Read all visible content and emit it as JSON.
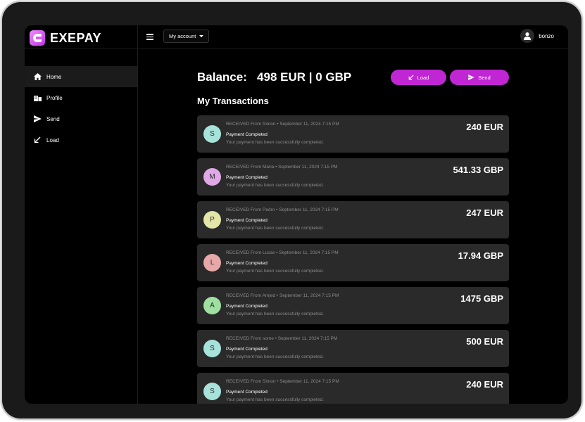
{
  "app": {
    "name": "EXEPAY"
  },
  "header": {
    "account_menu": "My account",
    "username": "bonzo"
  },
  "sidebar": {
    "items": [
      {
        "label": "Home",
        "icon": "home-icon",
        "active": true
      },
      {
        "label": "Profile",
        "icon": "profile-icon",
        "active": false
      },
      {
        "label": "Send",
        "icon": "send-icon",
        "active": false
      },
      {
        "label": "Load",
        "icon": "load-icon",
        "active": false
      }
    ]
  },
  "balance": {
    "label": "Balance:",
    "value": "498 EUR | 0 GBP"
  },
  "actions": {
    "load_label": "Load",
    "send_label": "Send"
  },
  "transactions_title": "My Transactions",
  "transactions": [
    {
      "initial": "S",
      "avatar_color": "#a7e3da",
      "meta": "RECEIVED From Simon • September 11, 2024 7:15 PM",
      "status": "Payment Completed",
      "description": "Your payment has been successfully completed.",
      "amount": "240 EUR"
    },
    {
      "initial": "M",
      "avatar_color": "#e0a8e6",
      "meta": "RECEIVED From Maria • September 11, 2024 7:15 PM",
      "status": "Payment Completed",
      "description": "Your payment has been successfully completed.",
      "amount": "541.33 GBP"
    },
    {
      "initial": "P",
      "avatar_color": "#e3e6a6",
      "meta": "RECEIVED From Pedro • September 11, 2024 7:15 PM",
      "status": "Payment Completed",
      "description": "Your payment has been successfully completed.",
      "amount": "247 EUR"
    },
    {
      "initial": "L",
      "avatar_color": "#e8a8a8",
      "meta": "RECEIVED From Lucas • September 11, 2024 7:15 PM",
      "status": "Payment Completed",
      "description": "Your payment has been successfully completed.",
      "amount": "17.94 GBP"
    },
    {
      "initial": "A",
      "avatar_color": "#9fe0a0",
      "meta": "RECEIVED From Amjed • September 11, 2024 7:15 PM",
      "status": "Payment Completed",
      "description": "Your payment has been successfully completed.",
      "amount": "1475 GBP"
    },
    {
      "initial": "S",
      "avatar_color": "#a7e3da",
      "meta": "RECEIVED From some • September 11, 2024 7:15 PM",
      "status": "Payment Completed",
      "description": "Your payment has been successfully completed.",
      "amount": "500 EUR"
    },
    {
      "initial": "S",
      "avatar_color": "#a7e3da",
      "meta": "RECEIVED From Simon • September 11, 2024 7:15 PM",
      "status": "Payment Completed",
      "description": "Your payment has been successfully completed.",
      "amount": "240 EUR"
    }
  ],
  "colors": {
    "accent": "#c026d3",
    "card": "#2a2a2a",
    "background": "#000000"
  }
}
